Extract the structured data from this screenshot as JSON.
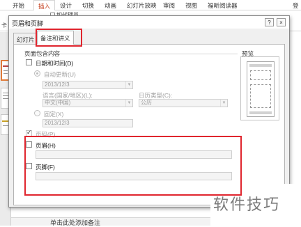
{
  "ribbon": {
    "tabs": [
      "开始",
      "插入",
      "设计",
      "切换",
      "动画",
      "幻灯片放映",
      "审阅",
      "视图",
      "福昕阅读器"
    ],
    "cmd1": "如代理员",
    "cmd2": "卡",
    "right_text": "登"
  },
  "dialog": {
    "title": "页眉和页脚",
    "help": "?",
    "close": "×",
    "tabs": [
      "幻灯片",
      "备注和讲义"
    ],
    "group_label": "页面包含内容",
    "datetime_label": "日期和时间(D)",
    "auto_update_label": "自动更新(U)",
    "date_value": "2013/12/3",
    "language_label": "语言(国家/地区)(L):",
    "language_value": "中文(中国)",
    "calendar_label": "日历类型(C):",
    "calendar_value": "公历",
    "fixed_label": "固定(X)",
    "fixed_value": "2013/12/3",
    "page_number_label": "页码(P)",
    "header_label": "页眉(H)",
    "footer_label": "页脚(F)",
    "preview_label": "预览"
  },
  "notes": {
    "placeholder": "单击此处添加备注"
  },
  "watermark": {
    "text": "软件技巧"
  },
  "colors": {
    "highlight": "#e0252e",
    "accent": "#c43e1c"
  }
}
